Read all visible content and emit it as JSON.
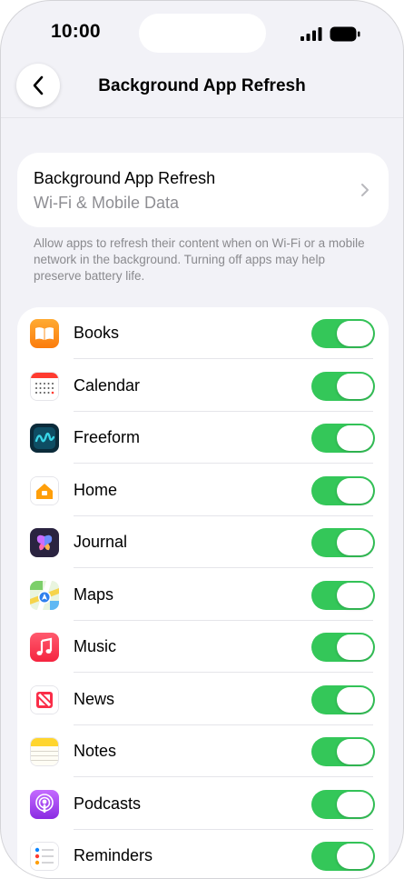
{
  "status_bar": {
    "time": "10:00"
  },
  "nav": {
    "title": "Background App Refresh",
    "back_icon": "chevron-left-icon"
  },
  "setting": {
    "title": "Background App Refresh",
    "value": "Wi-Fi & Mobile Data"
  },
  "footnote": "Allow apps to refresh their content when on Wi-Fi or a mobile network in the background. Turning off apps may help preserve battery life.",
  "accent_color": "#34c759",
  "apps": [
    {
      "label": "Books",
      "icon": "books-app-icon",
      "enabled": true
    },
    {
      "label": "Calendar",
      "icon": "calendar-app-icon",
      "enabled": true
    },
    {
      "label": "Freeform",
      "icon": "freeform-app-icon",
      "enabled": true
    },
    {
      "label": "Home",
      "icon": "home-app-icon",
      "enabled": true
    },
    {
      "label": "Journal",
      "icon": "journal-app-icon",
      "enabled": true
    },
    {
      "label": "Maps",
      "icon": "maps-app-icon",
      "enabled": true
    },
    {
      "label": "Music",
      "icon": "music-app-icon",
      "enabled": true
    },
    {
      "label": "News",
      "icon": "news-app-icon",
      "enabled": true
    },
    {
      "label": "Notes",
      "icon": "notes-app-icon",
      "enabled": true
    },
    {
      "label": "Podcasts",
      "icon": "podcasts-app-icon",
      "enabled": true
    },
    {
      "label": "Reminders",
      "icon": "reminders-app-icon",
      "enabled": true
    }
  ]
}
